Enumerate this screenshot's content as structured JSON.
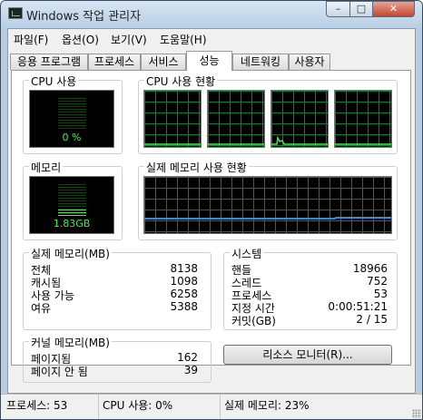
{
  "window": {
    "title": "Windows 작업 관리자",
    "controls": {
      "minimize": "–",
      "maximize": "□",
      "close": "✕"
    }
  },
  "menu": [
    "파일(F)",
    "옵션(O)",
    "보기(V)",
    "도움말(H)"
  ],
  "tabs": [
    "응용 프로그램",
    "프로세스",
    "서비스",
    "성능",
    "네트워킹",
    "사용자"
  ],
  "active_tab": "성능",
  "cpu_usage": {
    "title": "CPU 사용",
    "label": "0 %",
    "level_percent": 0
  },
  "cpu_history": {
    "title": "CPU 사용 현황",
    "cores": 4
  },
  "memory": {
    "title": "메모리",
    "label": "1.83GB",
    "level_percent": 23
  },
  "memory_history": {
    "title": "실제 메모리 사용 현황"
  },
  "physical_memory": {
    "title": "실제 메모리(MB)",
    "rows": [
      {
        "label": "전체",
        "value": "8138"
      },
      {
        "label": "캐시됨",
        "value": "1098"
      },
      {
        "label": "사용 가능",
        "value": "6258"
      },
      {
        "label": "여유",
        "value": "5388"
      }
    ]
  },
  "kernel_memory": {
    "title": "커널 메모리(MB)",
    "rows": [
      {
        "label": "페이지됨",
        "value": "162"
      },
      {
        "label": "페이지 안 됨",
        "value": "39"
      }
    ]
  },
  "system": {
    "title": "시스템",
    "rows": [
      {
        "label": "핸들",
        "value": "18966"
      },
      {
        "label": "스레드",
        "value": "752"
      },
      {
        "label": "프로세스",
        "value": "53"
      },
      {
        "label": "지정 시간",
        "value": "0:00:51:21"
      },
      {
        "label": "커밋(GB)",
        "value": "2 / 15"
      }
    ]
  },
  "resource_monitor_button": "리소스 모니터(R)...",
  "status": {
    "processes": "프로세스: 53",
    "cpu": "CPU 사용: 0%",
    "memory": "실제 메모리: 23%"
  },
  "colors": {
    "graph_background": "#000000",
    "graph_grid": "#0a7f3c",
    "meter_on": "#3cf33c",
    "cpu_line": "#3cf33c",
    "memory_line": "#2a8fe6"
  }
}
